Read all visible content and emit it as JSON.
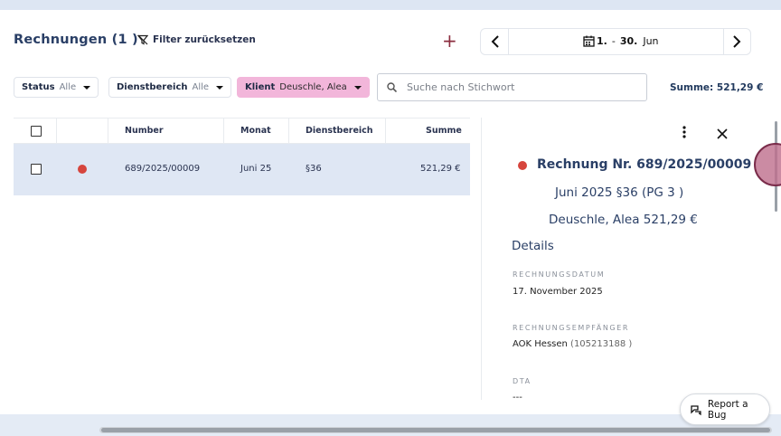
{
  "header": {
    "title": "Rechnungen (1 )",
    "filter_reset_label": "Filter zurücksetzen",
    "add_label": "+",
    "date_range": {
      "start": "1.",
      "sep": "-",
      "end": "30.",
      "month": "Jun"
    }
  },
  "filters": {
    "status": {
      "label": "Status",
      "value": "Alle"
    },
    "dienstbereich": {
      "label": "Dienstbereich",
      "value": "Alle"
    },
    "klient": {
      "label": "Klient",
      "value": "Deuschle, Alea",
      "color": "#f2b6da"
    },
    "search_placeholder": "Suche nach Stichwort",
    "summe_total": "Summe: 521,29 €"
  },
  "table": {
    "columns": [
      "Number",
      "Monat",
      "Dienstbereich",
      "Summe"
    ],
    "rows": [
      {
        "status_color": "#d6453d",
        "number": "689/2025/00009",
        "monat": "Juni 25",
        "dienstbereich": "§36",
        "summe": "521,29 €"
      }
    ]
  },
  "detail": {
    "status_color": "#d6453d",
    "title": "Rechnung Nr. 689/2025/00009",
    "line2": "Juni 2025 §36 (PG 3 )",
    "line3": "Deuschle, Alea 521,29 €",
    "details_heading": "Details",
    "rechnungsdatum_label": "RECHNUNGSDATUM",
    "rechnungsdatum": "17. November 2025",
    "empfaenger_label": "RECHNUNGSEMPFÄNGER",
    "empfaenger_name": "AOK Hessen",
    "empfaenger_id": "(105213188 )",
    "dta_label": "DTA",
    "dta_value": "---"
  },
  "report_bug_label": "Report a Bug"
}
